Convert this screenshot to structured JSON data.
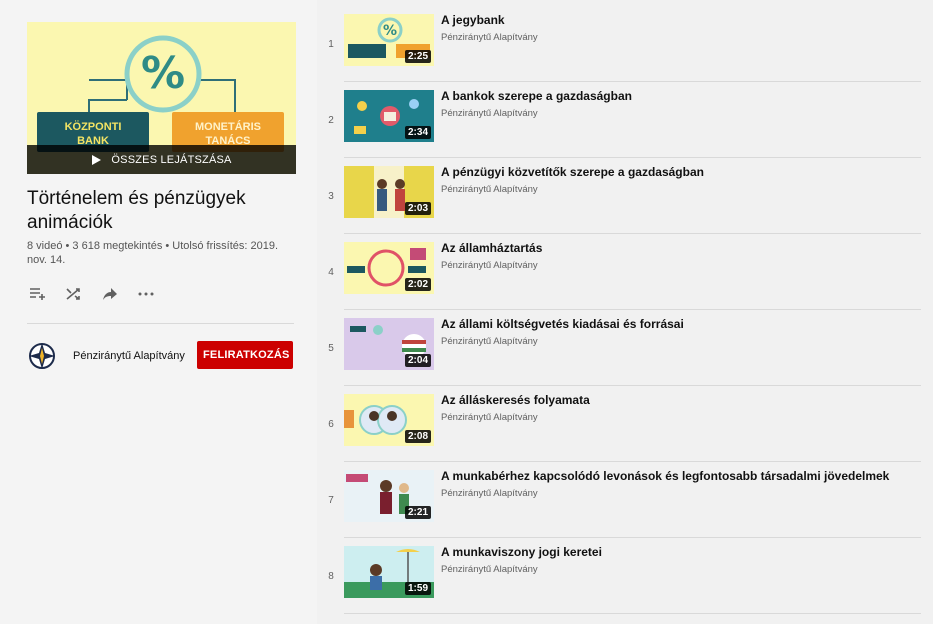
{
  "playlist": {
    "play_all_label": "ÖSSZES LEJÁTSZÁSA",
    "title": "Történelem és pénzügyek animációk",
    "meta": "8 videó • 3 618 megtekintés • Utolsó frissítés: 2019. nov. 14.",
    "cover": {
      "label_left": "KÖZPONTI\nBANK",
      "label_right": "MONETÁRIS\nTANÁCS"
    }
  },
  "owner": {
    "name": "Pénziránytű Alapítvány",
    "subscribe_label": "FELIRATKOZÁS"
  },
  "icons": {
    "add_to_queue": "playlist-add-icon",
    "shuffle": "shuffle-icon",
    "share": "share-icon",
    "more": "more-icon"
  },
  "colors": {
    "subscribe": "#cc0000",
    "sidebar_bg": "#f4f4f4",
    "list_bg": "#f1f1f1"
  },
  "videos": [
    {
      "index": "1",
      "title": "A jegybank",
      "channel": "Pénziránytű Alapítvány",
      "duration": "2:25",
      "thumb_bg": "#fbf7b0"
    },
    {
      "index": "2",
      "title": "A bankok szerepe a gazdaságban",
      "channel": "Pénziránytű Alapítvány",
      "duration": "2:34",
      "thumb_bg": "#1f7f8c"
    },
    {
      "index": "3",
      "title": "A pénzügyi közvetítők szerepe a gazdaságban",
      "channel": "Pénziránytű Alapítvány",
      "duration": "2:03",
      "thumb_bg": "#e8d64a"
    },
    {
      "index": "4",
      "title": "Az államháztartás",
      "channel": "Pénziránytű Alapítvány",
      "duration": "2:02",
      "thumb_bg": "#fbf7b0"
    },
    {
      "index": "5",
      "title": "Az állami költségvetés kiadásai és forrásai",
      "channel": "Pénziránytű Alapítvány",
      "duration": "2:04",
      "thumb_bg": "#d9c9ea"
    },
    {
      "index": "6",
      "title": "Az álláskeresés folyamata",
      "channel": "Pénziránytű Alapítvány",
      "duration": "2:08",
      "thumb_bg": "#fbf7b0"
    },
    {
      "index": "7",
      "title": "A munkabérhez kapcsolódó levonások és legfontosabb társadalmi jövedelmek",
      "channel": "Pénziránytű Alapítvány",
      "duration": "2:21",
      "thumb_bg": "#e9f2f6"
    },
    {
      "index": "8",
      "title": "A munkaviszony jogi keretei",
      "channel": "Pénziránytű Alapítvány",
      "duration": "1:59",
      "thumb_bg": "#cdeef0"
    }
  ]
}
